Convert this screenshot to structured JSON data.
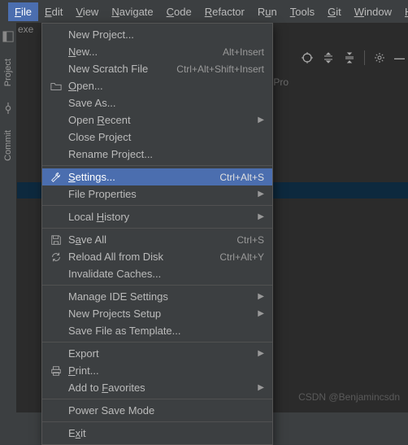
{
  "menubar": {
    "items": [
      {
        "label": "File",
        "uChar": "F",
        "rest": "ile",
        "active": true
      },
      {
        "label": "Edit",
        "uChar": "E",
        "rest": "dit"
      },
      {
        "label": "View",
        "uChar": "V",
        "rest": "iew"
      },
      {
        "label": "Navigate",
        "uChar": "N",
        "rest": "avigate"
      },
      {
        "label": "Code",
        "uChar": "C",
        "rest": "ode"
      },
      {
        "label": "Refactor",
        "uChar": "R",
        "rest": "efactor"
      },
      {
        "label": "Run",
        "pre": "R",
        "uChar": "u",
        "rest": "n"
      },
      {
        "label": "Tools",
        "uChar": "T",
        "rest": "ools"
      },
      {
        "label": "Git",
        "pre": "",
        "uChar": "G",
        "rest": "it"
      },
      {
        "label": "Window",
        "uChar": "W",
        "rest": "indow"
      },
      {
        "label": "Help",
        "uChar": "H",
        "rest": "elp"
      }
    ]
  },
  "sidebar": {
    "project": "Project",
    "commit": "Commit"
  },
  "bg": {
    "trace": "exe",
    "text": "clePro"
  },
  "watermark": "CSDN @Benjamincsdn",
  "file_menu": {
    "groups": [
      [
        {
          "label": "New Project...",
          "icon": null
        },
        {
          "label": "New...",
          "uPre": "",
          "uChar": "N",
          "uRest": "ew...",
          "shortcut": "Alt+Insert"
        },
        {
          "label": "New Scratch File",
          "shortcut": "Ctrl+Alt+Shift+Insert"
        },
        {
          "label": "Open...",
          "uPre": "",
          "uChar": "O",
          "uRest": "pen...",
          "icon": "open"
        },
        {
          "label": "Save As...",
          "uPost_special": true,
          "text": "Save As..."
        },
        {
          "label": "Open Recent",
          "uPre": "Open ",
          "uChar": "R",
          "uRest": "ecent",
          "submenu": true
        },
        {
          "label": "Close Project",
          "uPre": "Close Pro",
          "uChar": "j",
          "uRest": "ect"
        },
        {
          "label": "Rename Project..."
        }
      ],
      [
        {
          "label": "Settings...",
          "uPre": "",
          "uChar": "S",
          "uRest": "ettings...",
          "icon": "wrench",
          "shortcut": "Ctrl+Alt+S",
          "selected": true
        },
        {
          "label": "File Properties",
          "submenu": true
        }
      ],
      [
        {
          "label": "Local History",
          "uPre": "Local ",
          "uChar": "H",
          "uRest": "istory",
          "submenu": true
        }
      ],
      [
        {
          "label": "Save All",
          "uPre": "S",
          "uChar": "a",
          "uRest": "ve All",
          "icon": "save",
          "shortcut": "Ctrl+S"
        },
        {
          "label": "Reload All from Disk",
          "icon": "reload",
          "shortcut": "Ctrl+Alt+Y"
        },
        {
          "label": "Invalidate Caches..."
        }
      ],
      [
        {
          "label": "Manage IDE Settings",
          "submenu": true
        },
        {
          "label": "New Projects Setup",
          "submenu": true
        },
        {
          "label": "Save File as Template..."
        }
      ],
      [
        {
          "label": "Export",
          "submenu": true
        },
        {
          "label": "Print...",
          "uPre": "",
          "uChar": "P",
          "uRest": "rint...",
          "icon": "print"
        },
        {
          "label": "Add to Favorites",
          "uPre": "Add to ",
          "uChar": "F",
          "uRest": "avorites",
          "submenu": true
        }
      ],
      [
        {
          "label": "Power Save Mode"
        }
      ],
      [
        {
          "label": "Exit",
          "uPre": "E",
          "uChar": "x",
          "uRest": "it"
        }
      ]
    ]
  }
}
